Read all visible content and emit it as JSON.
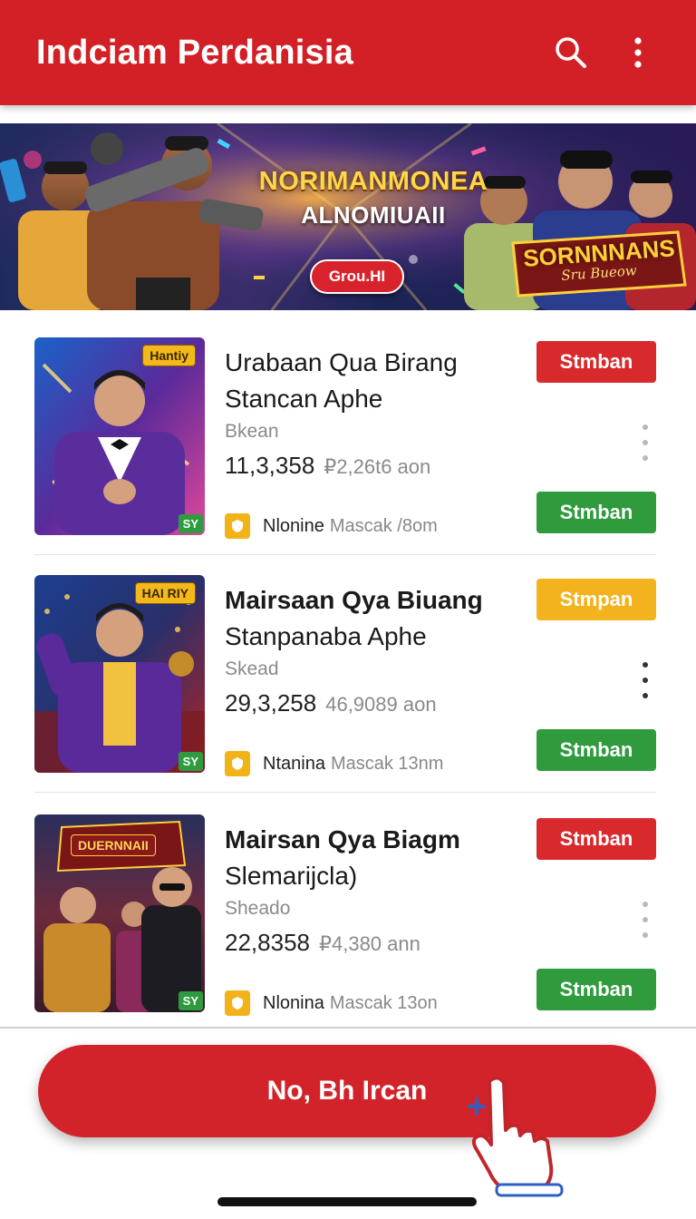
{
  "appbar": {
    "title": "Indciam Perdanisia",
    "search_icon": "search-icon",
    "menu_icon": "more-vertical-icon",
    "color": "#d32027"
  },
  "banner": {
    "headline_line1": "NORIMANMONEA",
    "headline_line2": "ALNOMIUAII",
    "cta_label": "Grou.HI",
    "logo_text": "SORNNNANS",
    "logo_subtext": "Sru Bueow"
  },
  "items": [
    {
      "name_line1": "Urabaan Qua Birang",
      "name_line2": "Stancan Aphe",
      "subtitle": "Bkean",
      "stat_main": "11,3,358",
      "stat_secondary": "₽2,26t6 aon",
      "meta_name": "Nlonine",
      "meta_rest": "Mascak /8om",
      "thumb_tag": "Hantiy",
      "thumb_corner": "SY",
      "top_button": "Stmban",
      "bottom_button": "Stmban"
    },
    {
      "name_line1": "Mairsaan Qya Biuang",
      "name_line2": "Stanpanaba Aphe",
      "subtitle": "Skead",
      "stat_main": "29,3,258",
      "stat_secondary": "46,9089 aon",
      "meta_name": "Ntanina",
      "meta_rest": "Mascak 13nm",
      "thumb_tag": "HAI RIY",
      "thumb_corner": "SY",
      "top_button": "Stmpan",
      "bottom_button": "Stmban"
    },
    {
      "name_line1": "Mairsan Qya Biagm",
      "name_line2": "Slemarijcla)",
      "subtitle": "Sheado",
      "stat_main": "22,8358",
      "stat_secondary": "₽4,380 ann",
      "meta_name": "Nlonina",
      "meta_rest": "Mascak 13on",
      "thumb_tag": "DUERNNAII",
      "thumb_corner": "SY",
      "top_button": "Stmban",
      "bottom_button": "Stmban"
    }
  ],
  "main_cta": {
    "label": "No, Bh Ircan"
  },
  "colors": {
    "primary_red": "#d32027",
    "button_yellow": "#f2b31e",
    "button_green": "#2f9b3d"
  }
}
